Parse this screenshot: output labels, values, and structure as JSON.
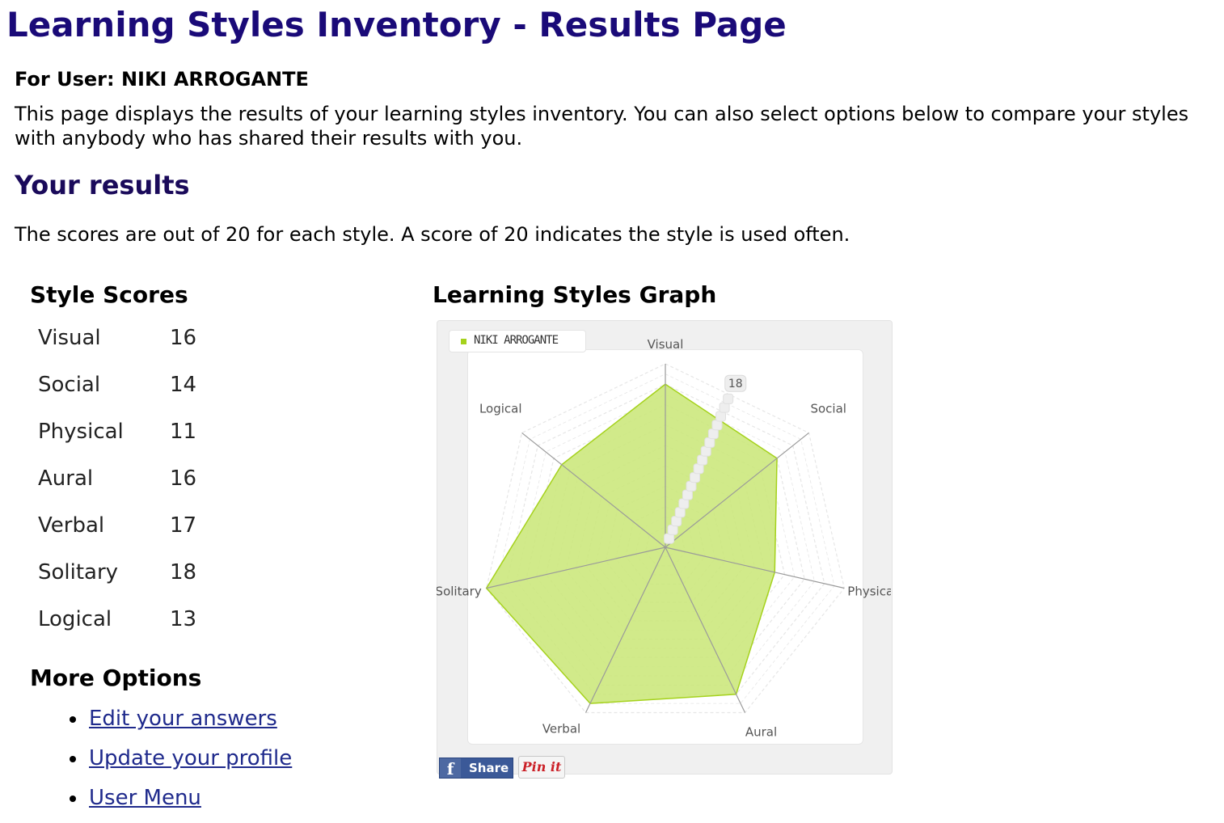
{
  "title": "Learning Styles Inventory - Results Page",
  "user_line": "For User: NIKI ARROGANTE",
  "intro": "This page displays the results of your learning styles inventory. You can also select options below to compare your styles with anybody who has shared their results with you.",
  "results_heading": "Your results",
  "explain": "The scores are out of 20 for each style. A score of 20 indicates the style is used often.",
  "scores_heading": "Style Scores",
  "scores": [
    {
      "name": "Visual",
      "value": "16"
    },
    {
      "name": "Social",
      "value": "14"
    },
    {
      "name": "Physical",
      "value": "11"
    },
    {
      "name": "Aural",
      "value": "16"
    },
    {
      "name": "Verbal",
      "value": "17"
    },
    {
      "name": "Solitary",
      "value": "18"
    },
    {
      "name": "Logical",
      "value": "13"
    }
  ],
  "graph_heading": "Learning Styles Graph",
  "share": {
    "facebook_icon": "f",
    "facebook_label": "Share",
    "pinterest_label": "Pin it"
  },
  "options_heading": "More Options",
  "options": [
    {
      "label": "Edit your answers"
    },
    {
      "label": "Update your profile"
    },
    {
      "label": "User Menu"
    }
  ],
  "chart_data": {
    "type": "radar",
    "legend": "NIKI ARROGANTE",
    "axes": [
      "Visual",
      "Social",
      "Physical",
      "Aural",
      "Verbal",
      "Solitary",
      "Logical"
    ],
    "series": [
      {
        "name": "NIKI ARROGANTE",
        "values": [
          16,
          14,
          11,
          16,
          17,
          18,
          13
        ]
      }
    ],
    "rmax_label": "18",
    "fill_color": "#c9e676",
    "line_color": "#a5d21c"
  }
}
